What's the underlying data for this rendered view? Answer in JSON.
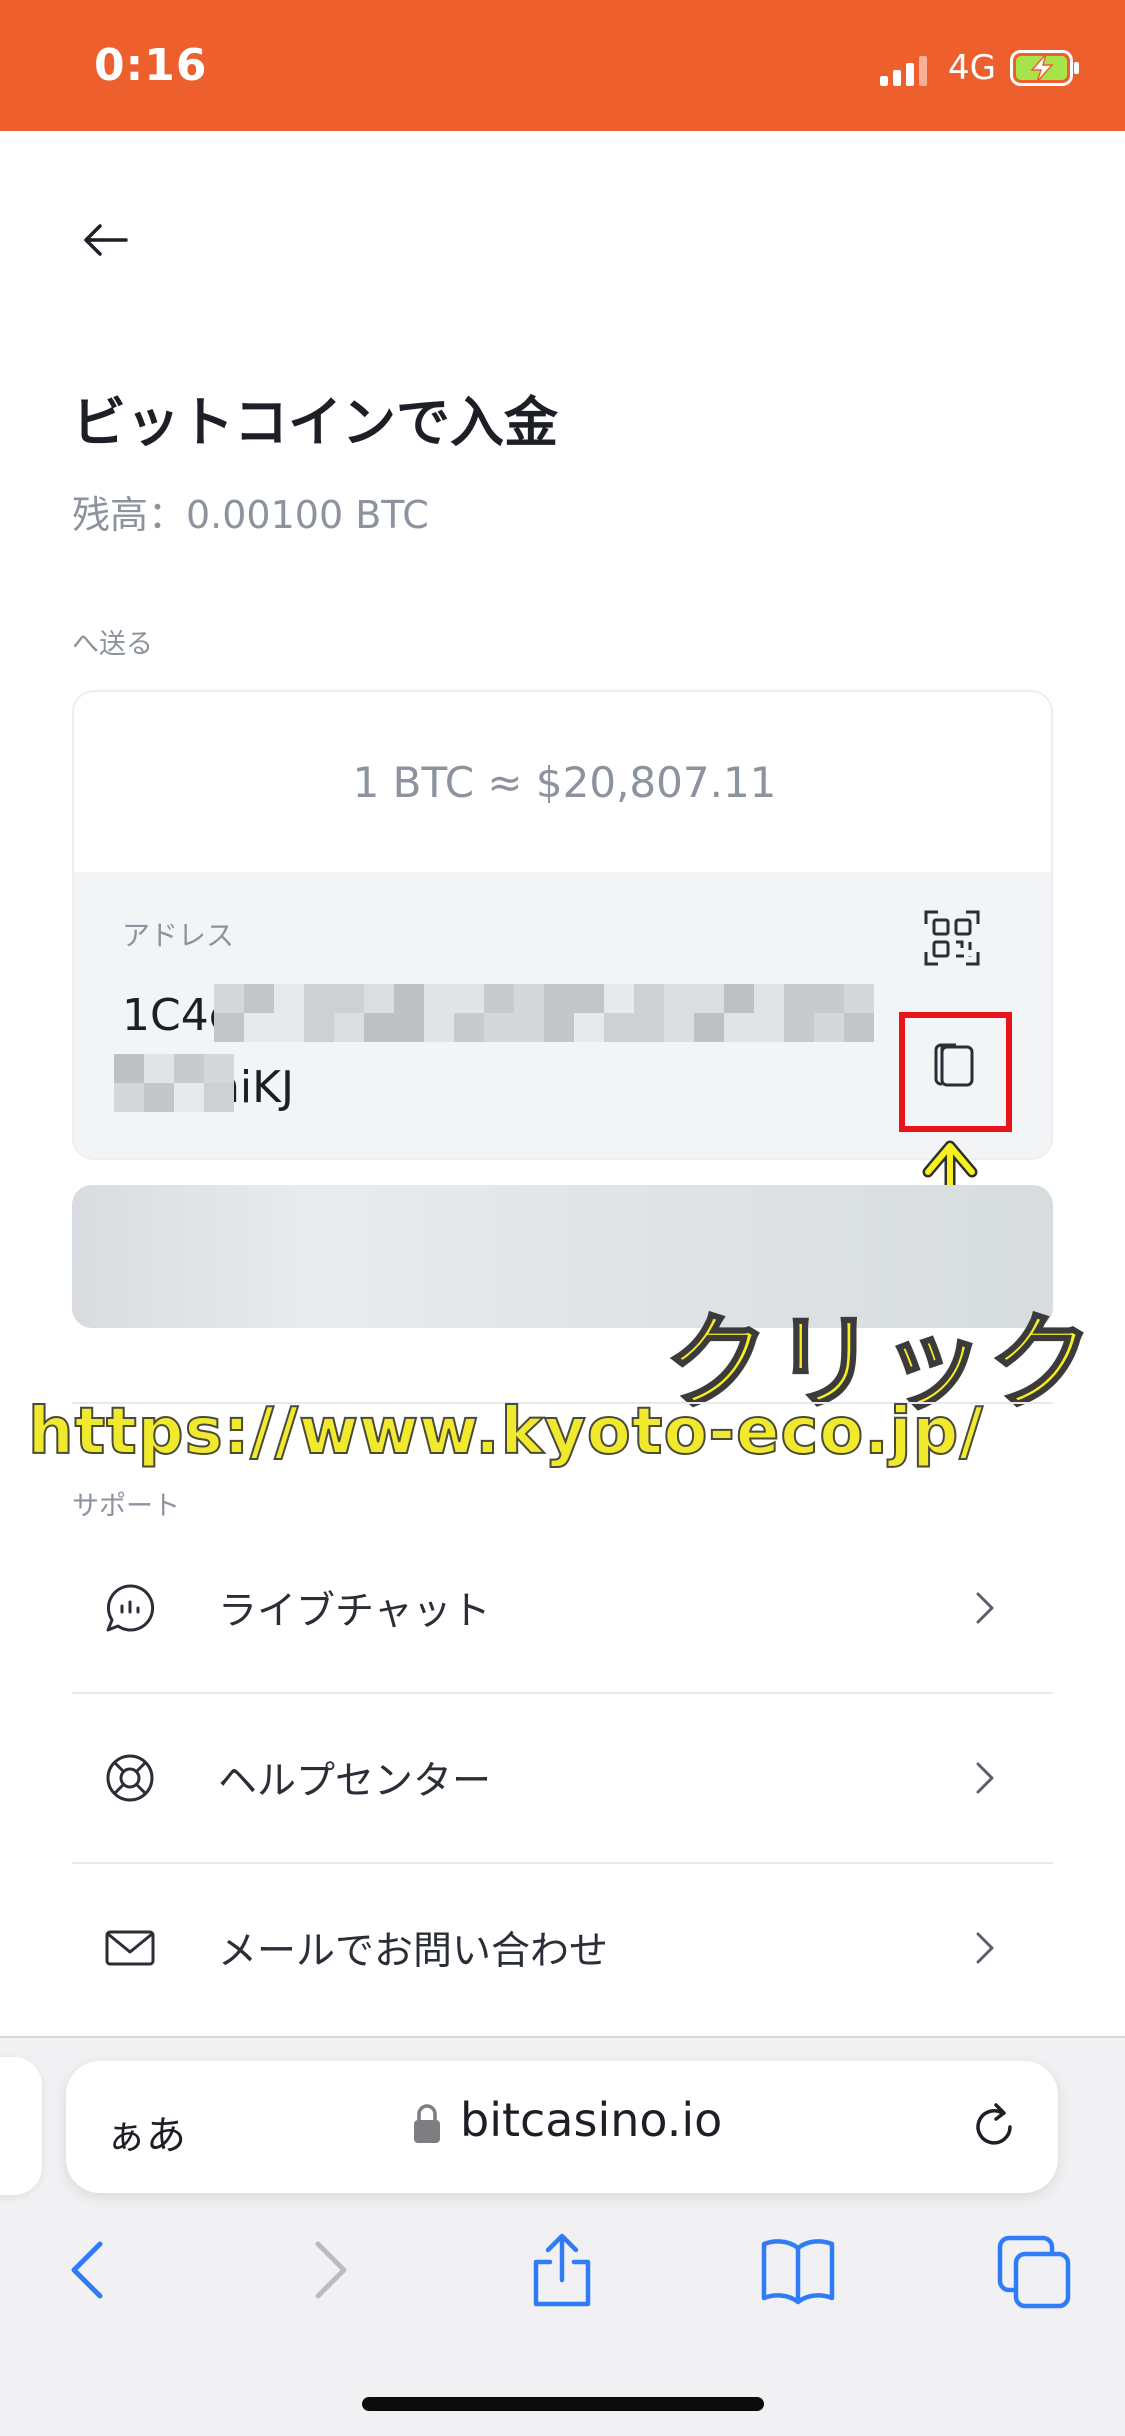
{
  "status": {
    "time": "0:16",
    "network": "4G"
  },
  "page": {
    "title": "ビットコインで入金",
    "balance": "残高：0.00100 BTC",
    "send_section_label": "へ送る"
  },
  "card": {
    "rate": "1 BTC ≈ $20,807.11",
    "address_label": "アドレス",
    "address_line1": "1C4c",
    "address_line2": "niKJ"
  },
  "annotation": {
    "click_label": "クリック",
    "watermark": "https://www.kyoto-eco.jp/"
  },
  "support": {
    "section_label": "サポート",
    "items": [
      {
        "label": "ライブチャット",
        "icon": "chat-bubble-icon"
      },
      {
        "label": "ヘルプセンター",
        "icon": "lifebuoy-icon"
      },
      {
        "label": "メールでお問い合わせ",
        "icon": "envelope-icon"
      }
    ]
  },
  "browser": {
    "aa_label": "ぁあ",
    "url": "bitcasino.io"
  },
  "colors": {
    "accent": "#ee5f2e",
    "highlight": "#e8141b",
    "annotation": "#f7ef22",
    "ios_blue": "#2f7cf6"
  }
}
